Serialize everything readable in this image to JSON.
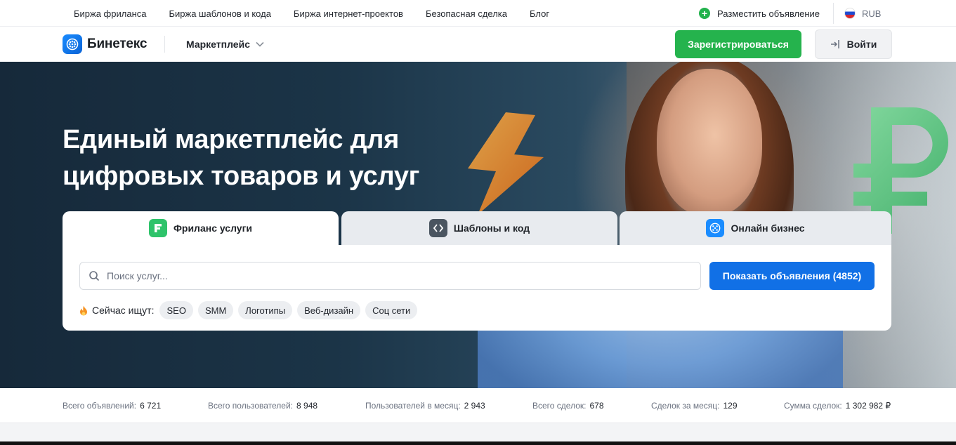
{
  "topbar": {
    "links": [
      "Биржа фриланса",
      "Биржа шаблонов и кода",
      "Биржа интернет-проектов",
      "Безопасная сделка",
      "Блог"
    ],
    "post_ad": "Разместить объявление",
    "currency": "RUB"
  },
  "header": {
    "logo_text": "Бинетекс",
    "marketplace_label": "Маркетплейс",
    "register_label": "Зарегистрироваться",
    "login_label": "Войти"
  },
  "hero": {
    "title_line1": "Единый маркетплейс для",
    "title_line2": "цифровых товаров и услуг"
  },
  "search": {
    "tabs": [
      {
        "label": "Фриланс услуги",
        "active": true,
        "icon": "freelance-icon",
        "color": "#2ec36a"
      },
      {
        "label": "Шаблоны и код",
        "active": false,
        "icon": "code-icon",
        "color": "#4a5560"
      },
      {
        "label": "Онлайн бизнес",
        "active": false,
        "icon": "business-icon",
        "color": "#1a8cff"
      }
    ],
    "placeholder": "Поиск услуг...",
    "button_label": "Показать объявления (4852)",
    "trending_label": "Сейчас ищут:",
    "chips": [
      "SEO",
      "SMM",
      "Логотипы",
      "Веб-дизайн",
      "Соц сети"
    ]
  },
  "stats": [
    {
      "label": "Всего объявлений:",
      "value": "6 721"
    },
    {
      "label": "Всего пользователей:",
      "value": "8 948"
    },
    {
      "label": "Пользователей в месяц:",
      "value": "2 943"
    },
    {
      "label": "Всего сделок:",
      "value": "678"
    },
    {
      "label": "Сделок за месяц:",
      "value": "129"
    },
    {
      "label": "Сумма сделок:",
      "value": "1 302 982 ₽"
    }
  ],
  "colors": {
    "register": "#25b34d",
    "primary": "#1170e6",
    "hero_dark": "#16293a"
  }
}
